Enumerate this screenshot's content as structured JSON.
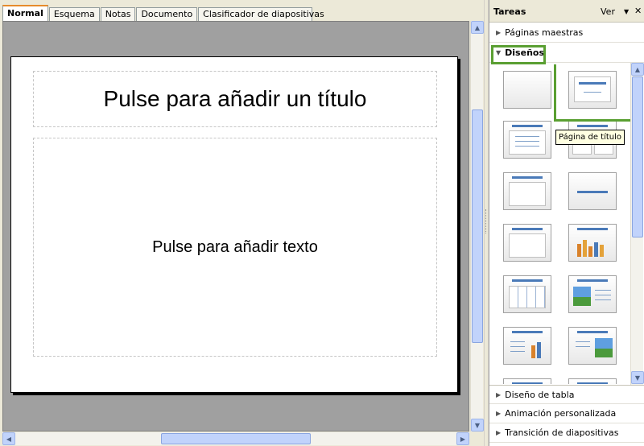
{
  "tabs": [
    "Normal",
    "Esquema",
    "Notas",
    "Documento",
    "Clasificador de diapositivas"
  ],
  "slide": {
    "title_placeholder": "Pulse para añadir un título",
    "body_placeholder": "Pulse para añadir texto"
  },
  "task_pane": {
    "title": "Tareas",
    "view_menu": "Ver",
    "sections": {
      "master_pages": "Páginas maestras",
      "layouts": "Diseños",
      "table_design": "Diseño de tabla",
      "custom_animation": "Animación personalizada",
      "slide_transition": "Transición de diapositivas"
    },
    "tooltip": "Página de título"
  },
  "colors": {
    "highlight": "#5a9f32",
    "active_tab_accent": "#e68b2c",
    "scroll_blue": "#c1d3fb"
  }
}
